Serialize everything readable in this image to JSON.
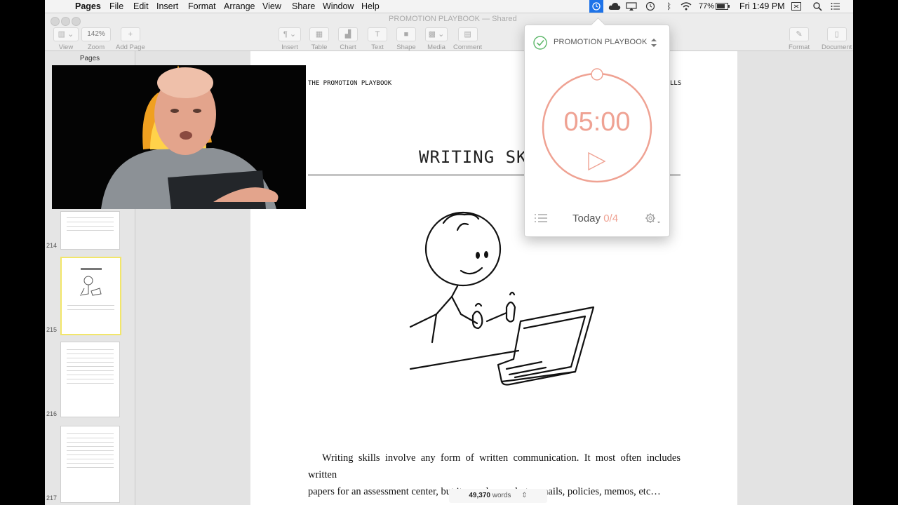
{
  "menubar": {
    "app_name": "Pages",
    "menus": [
      "File",
      "Edit",
      "Insert",
      "Format",
      "Arrange",
      "View",
      "Share",
      "Window",
      "Help"
    ],
    "battery": "77%",
    "clock": "Fri 1:49 PM"
  },
  "toolbar": {
    "doc_title": "PROMOTION PLAYBOOK",
    "doc_status": "— Shared",
    "zoom_value": "142%",
    "view_label": "View",
    "zoom_label": "Zoom",
    "add_page_label": "Add Page",
    "insert_label": "Insert",
    "table_label": "Table",
    "chart_label": "Chart",
    "text_label": "Text",
    "shape_label": "Shape",
    "media_label": "Media",
    "comment_label": "Comment",
    "format_label": "Format",
    "document_label": "Document"
  },
  "sidebar": {
    "title": "Pages",
    "page_numbers": [
      "214",
      "215",
      "216",
      "217"
    ]
  },
  "page": {
    "header_left": "THE PROMOTION PLAYBOOK",
    "header_right": "LLS",
    "heading": "WRITING SK",
    "para_line1": "Writing skills involve any form of written communication. It most often includes written",
    "para_line2": "papers for an assessment center, but it can also apply to emails, policies, memos, etc…"
  },
  "word_count": {
    "count": "49,370",
    "unit": "words"
  },
  "timer": {
    "project": "PROMOTION PLAYBOOK",
    "time": "05:00",
    "today_label": "Today",
    "today_count": "0/4",
    "accent": "#efa293"
  }
}
